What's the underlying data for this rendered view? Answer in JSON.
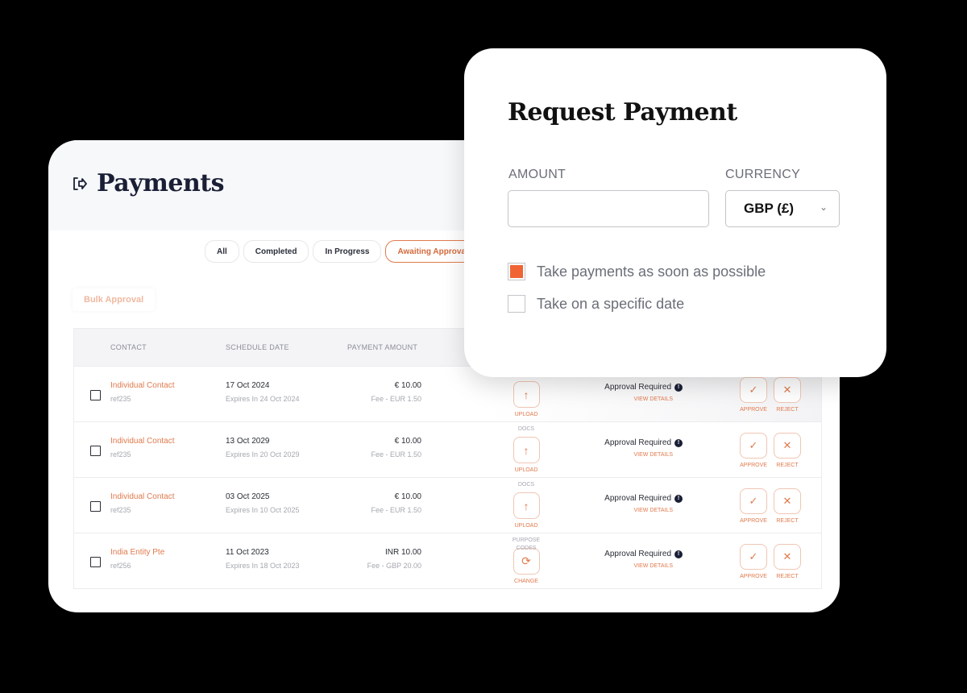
{
  "payments": {
    "title": "Payments",
    "filters": [
      {
        "label": "All",
        "active": false
      },
      {
        "label": "Completed",
        "active": false
      },
      {
        "label": "In Progress",
        "active": false
      },
      {
        "label": "Awaiting Approval",
        "active": true
      }
    ],
    "bulk_label": "Bulk Approval",
    "columns": {
      "contact": "CONTACT",
      "schedule": "SCHEDULE DATE",
      "amount": "PAYMENT AMOUNT"
    },
    "rows": [
      {
        "contact": "Individual Contact",
        "ref": "ref235",
        "date": "17 Oct 2024",
        "expires": "Expires In 24 Oct 2024",
        "amount": "€ 10.00",
        "fee": "Fee - EUR 1.50",
        "doc_caption": "",
        "doc_icon": "upload-icon",
        "doc_label": "UPLOAD",
        "status": "Approval Required",
        "view": "VIEW DETAILS",
        "approve": "APPROVE",
        "reject": "REJECT"
      },
      {
        "contact": "Individual Contact",
        "ref": "ref235",
        "date": "13 Oct 2029",
        "expires": "Expires In 20 Oct 2029",
        "amount": "€ 10.00",
        "fee": "Fee - EUR 1.50",
        "doc_caption": "DOCS",
        "doc_icon": "upload-icon",
        "doc_label": "UPLOAD",
        "status": "Approval Required",
        "view": "VIEW DETAILS",
        "approve": "APPROVE",
        "reject": "REJECT"
      },
      {
        "contact": "Individual Contact",
        "ref": "ref235",
        "date": "03 Oct 2025",
        "expires": "Expires In 10 Oct 2025",
        "amount": "€ 10.00",
        "fee": "Fee - EUR 1.50",
        "doc_caption": "DOCS",
        "doc_icon": "upload-icon",
        "doc_label": "UPLOAD",
        "status": "Approval Required",
        "view": "VIEW DETAILS",
        "approve": "APPROVE",
        "reject": "REJECT"
      },
      {
        "contact": "India Entity Pte",
        "ref": "ref256",
        "date": "11 Oct 2023",
        "expires": "Expires In 18 Oct 2023",
        "amount": "INR 10.00",
        "fee": "Fee - GBP 20.00",
        "doc_caption": "PURPOSE CODES",
        "doc_icon": "refresh-icon",
        "doc_label": "CHANGE",
        "status": "Approval Required",
        "view": "VIEW DETAILS",
        "approve": "APPROVE",
        "reject": "REJECT"
      }
    ]
  },
  "request": {
    "title": "Request Payment",
    "amount_label": "AMOUNT",
    "amount_value": "",
    "currency_label": "CURRENCY",
    "currency_value": "GBP (£)",
    "options": [
      {
        "label": "Take payments as soon as possible",
        "checked": true
      },
      {
        "label": "Take on a specific date",
        "checked": false
      }
    ]
  },
  "colors": {
    "accent": "#e07a4d",
    "checkbox_fill": "#f06434",
    "title": "#1a1f36"
  }
}
